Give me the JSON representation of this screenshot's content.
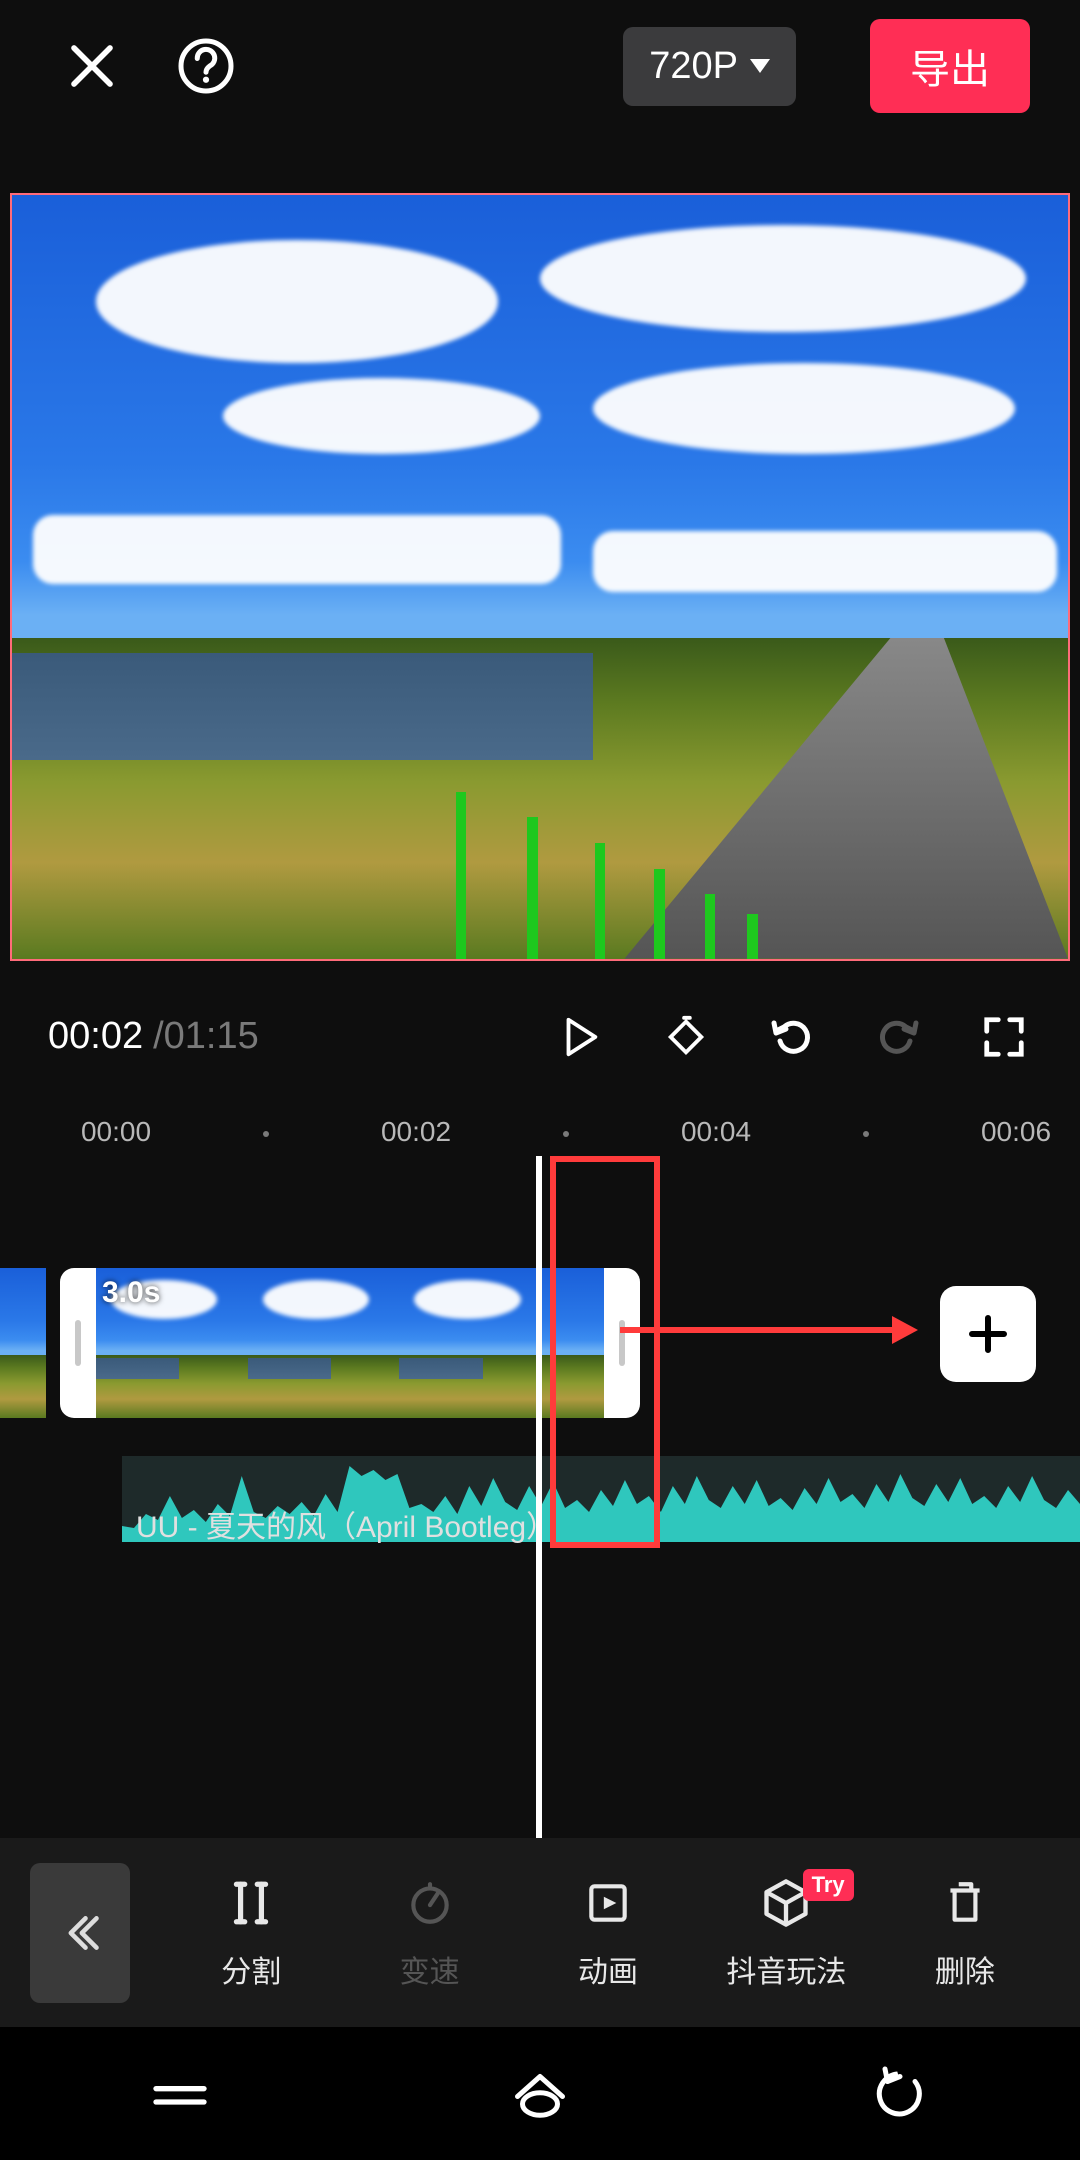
{
  "topbar": {
    "resolution_label": "720P",
    "export_label": "导出"
  },
  "player": {
    "current_time": "00:02",
    "separator": " / ",
    "duration": "01:15"
  },
  "ruler": {
    "t0": "00:00",
    "t1": "00:02",
    "t2": "00:04",
    "t3": "00:06"
  },
  "clip": {
    "duration_badge": "3.0s"
  },
  "audio": {
    "label": "UU - 夏天的风（April Bootleg）"
  },
  "tools": {
    "split": "分割",
    "speed": "变速",
    "anim": "动画",
    "douyin": "抖音玩法",
    "delete": "删除",
    "try_badge": "Try"
  }
}
